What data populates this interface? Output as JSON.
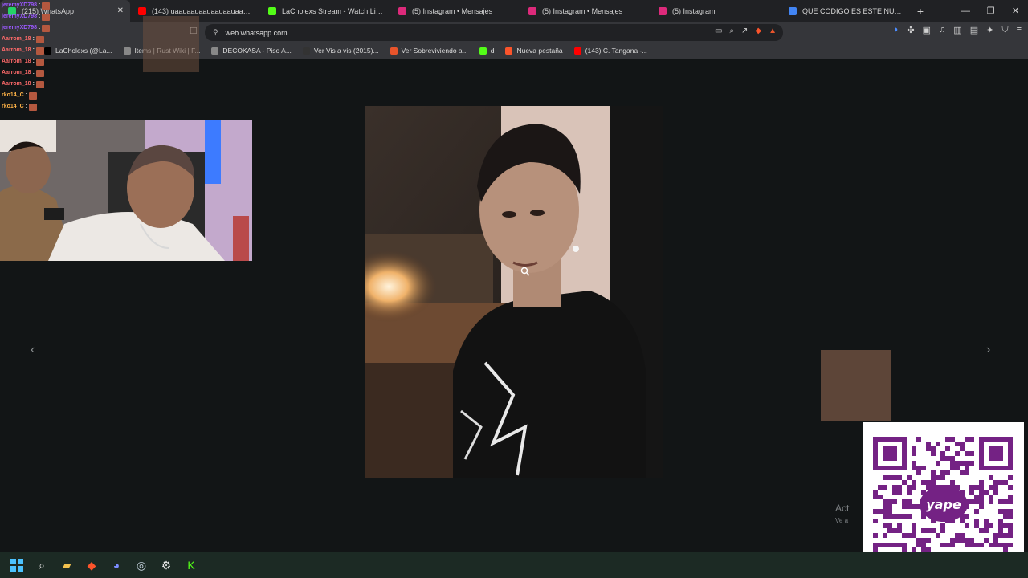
{
  "browser": {
    "tabs": [
      {
        "label": "(215) WhatsApp",
        "active": true,
        "color": "#25d366"
      },
      {
        "label": "(143) uaauaauaauaauaauaauaauaau",
        "active": false,
        "color": "#ff0000"
      },
      {
        "label": "LaCholexs Stream - Watch Live on Ki",
        "active": false,
        "color": "#53fc18"
      },
      {
        "label": "(5) Instagram • Mensajes",
        "active": false,
        "color": "#dd2a7b"
      },
      {
        "label": "(5) Instagram • Mensajes",
        "active": false,
        "color": "#dd2a7b"
      },
      {
        "label": "(5) Instagram",
        "active": false,
        "color": "#dd2a7b"
      },
      {
        "label": "QUE CODIGO ES ESTE NUMERO +5",
        "active": false,
        "color": "#4285f4"
      }
    ],
    "new_tab_label": "+",
    "window_controls": {
      "minimize": "—",
      "restore": "❐",
      "close": "✕"
    },
    "address": "web.whatsapp.com",
    "bookmarks": [
      {
        "label": "LaCholexs (@La...",
        "color": "#000000"
      },
      {
        "label": "Items | Rust Wiki | F...",
        "color": "#888888"
      },
      {
        "label": "DECOKASA - Piso A...",
        "color": "#888888"
      },
      {
        "label": "Ver Vis a vis (2015)...",
        "color": "#333333"
      },
      {
        "label": "Ver Sobreviviendo a...",
        "color": "#e8542b"
      },
      {
        "label": "d",
        "color": "#53fc18"
      },
      {
        "label": "Nueva pestaña",
        "color": "#fb542b"
      },
      {
        "label": "(143) C. Tangana -...",
        "color": "#ff0000"
      }
    ]
  },
  "stream_overlay": {
    "chat": [
      {
        "user": "jeremyXD798",
        "color": "#9b59ff"
      },
      {
        "user": "jeremyXD798",
        "color": "#9b59ff"
      },
      {
        "user": "jeremyXD798",
        "color": "#9b59ff"
      },
      {
        "user": "Aarrom_18",
        "color": "#ff6a6a"
      },
      {
        "user": "Aarrom_18",
        "color": "#ff6a6a"
      },
      {
        "user": "Aarrom_18",
        "color": "#ff6a6a"
      },
      {
        "user": "Aarrom_18",
        "color": "#ff6a6a"
      },
      {
        "user": "Aarrom_18",
        "color": "#ff6a6a"
      },
      {
        "user": "rko14_C",
        "color": "#ffb347"
      },
      {
        "user": "rko14_C",
        "color": "#ffb347"
      }
    ],
    "activate_windows": {
      "title": "Act",
      "subtitle": "Ve a"
    },
    "qr_brand": "yape",
    "qr_brand_color": "#742284"
  },
  "viewer": {
    "prev_icon": "‹",
    "next_icon": "›"
  },
  "taskbar": {
    "items": [
      "windows-start-icon",
      "search-icon",
      "file-explorer-icon",
      "brave-browser-icon",
      "discord-icon",
      "steam-icon",
      "settings-icon",
      "kick-icon"
    ]
  }
}
